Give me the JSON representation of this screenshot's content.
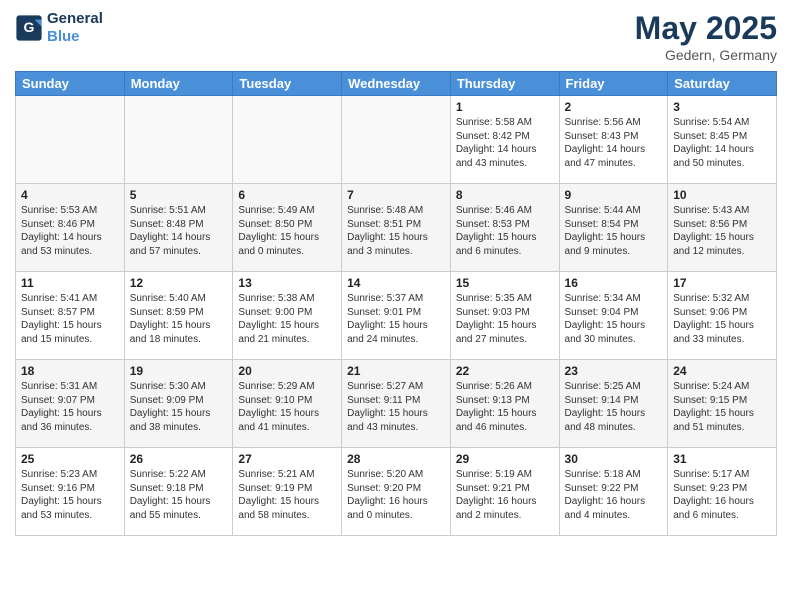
{
  "logo": {
    "line1": "General",
    "line2": "Blue"
  },
  "title": "May 2025",
  "subtitle": "Gedern, Germany",
  "days_header": [
    "Sunday",
    "Monday",
    "Tuesday",
    "Wednesday",
    "Thursday",
    "Friday",
    "Saturday"
  ],
  "weeks": [
    [
      {
        "day": "",
        "content": ""
      },
      {
        "day": "",
        "content": ""
      },
      {
        "day": "",
        "content": ""
      },
      {
        "day": "",
        "content": ""
      },
      {
        "day": "1",
        "content": "Sunrise: 5:58 AM\nSunset: 8:42 PM\nDaylight: 14 hours\nand 43 minutes."
      },
      {
        "day": "2",
        "content": "Sunrise: 5:56 AM\nSunset: 8:43 PM\nDaylight: 14 hours\nand 47 minutes."
      },
      {
        "day": "3",
        "content": "Sunrise: 5:54 AM\nSunset: 8:45 PM\nDaylight: 14 hours\nand 50 minutes."
      }
    ],
    [
      {
        "day": "4",
        "content": "Sunrise: 5:53 AM\nSunset: 8:46 PM\nDaylight: 14 hours\nand 53 minutes."
      },
      {
        "day": "5",
        "content": "Sunrise: 5:51 AM\nSunset: 8:48 PM\nDaylight: 14 hours\nand 57 minutes."
      },
      {
        "day": "6",
        "content": "Sunrise: 5:49 AM\nSunset: 8:50 PM\nDaylight: 15 hours\nand 0 minutes."
      },
      {
        "day": "7",
        "content": "Sunrise: 5:48 AM\nSunset: 8:51 PM\nDaylight: 15 hours\nand 3 minutes."
      },
      {
        "day": "8",
        "content": "Sunrise: 5:46 AM\nSunset: 8:53 PM\nDaylight: 15 hours\nand 6 minutes."
      },
      {
        "day": "9",
        "content": "Sunrise: 5:44 AM\nSunset: 8:54 PM\nDaylight: 15 hours\nand 9 minutes."
      },
      {
        "day": "10",
        "content": "Sunrise: 5:43 AM\nSunset: 8:56 PM\nDaylight: 15 hours\nand 12 minutes."
      }
    ],
    [
      {
        "day": "11",
        "content": "Sunrise: 5:41 AM\nSunset: 8:57 PM\nDaylight: 15 hours\nand 15 minutes."
      },
      {
        "day": "12",
        "content": "Sunrise: 5:40 AM\nSunset: 8:59 PM\nDaylight: 15 hours\nand 18 minutes."
      },
      {
        "day": "13",
        "content": "Sunrise: 5:38 AM\nSunset: 9:00 PM\nDaylight: 15 hours\nand 21 minutes."
      },
      {
        "day": "14",
        "content": "Sunrise: 5:37 AM\nSunset: 9:01 PM\nDaylight: 15 hours\nand 24 minutes."
      },
      {
        "day": "15",
        "content": "Sunrise: 5:35 AM\nSunset: 9:03 PM\nDaylight: 15 hours\nand 27 minutes."
      },
      {
        "day": "16",
        "content": "Sunrise: 5:34 AM\nSunset: 9:04 PM\nDaylight: 15 hours\nand 30 minutes."
      },
      {
        "day": "17",
        "content": "Sunrise: 5:32 AM\nSunset: 9:06 PM\nDaylight: 15 hours\nand 33 minutes."
      }
    ],
    [
      {
        "day": "18",
        "content": "Sunrise: 5:31 AM\nSunset: 9:07 PM\nDaylight: 15 hours\nand 36 minutes."
      },
      {
        "day": "19",
        "content": "Sunrise: 5:30 AM\nSunset: 9:09 PM\nDaylight: 15 hours\nand 38 minutes."
      },
      {
        "day": "20",
        "content": "Sunrise: 5:29 AM\nSunset: 9:10 PM\nDaylight: 15 hours\nand 41 minutes."
      },
      {
        "day": "21",
        "content": "Sunrise: 5:27 AM\nSunset: 9:11 PM\nDaylight: 15 hours\nand 43 minutes."
      },
      {
        "day": "22",
        "content": "Sunrise: 5:26 AM\nSunset: 9:13 PM\nDaylight: 15 hours\nand 46 minutes."
      },
      {
        "day": "23",
        "content": "Sunrise: 5:25 AM\nSunset: 9:14 PM\nDaylight: 15 hours\nand 48 minutes."
      },
      {
        "day": "24",
        "content": "Sunrise: 5:24 AM\nSunset: 9:15 PM\nDaylight: 15 hours\nand 51 minutes."
      }
    ],
    [
      {
        "day": "25",
        "content": "Sunrise: 5:23 AM\nSunset: 9:16 PM\nDaylight: 15 hours\nand 53 minutes."
      },
      {
        "day": "26",
        "content": "Sunrise: 5:22 AM\nSunset: 9:18 PM\nDaylight: 15 hours\nand 55 minutes."
      },
      {
        "day": "27",
        "content": "Sunrise: 5:21 AM\nSunset: 9:19 PM\nDaylight: 15 hours\nand 58 minutes."
      },
      {
        "day": "28",
        "content": "Sunrise: 5:20 AM\nSunset: 9:20 PM\nDaylight: 16 hours\nand 0 minutes."
      },
      {
        "day": "29",
        "content": "Sunrise: 5:19 AM\nSunset: 9:21 PM\nDaylight: 16 hours\nand 2 minutes."
      },
      {
        "day": "30",
        "content": "Sunrise: 5:18 AM\nSunset: 9:22 PM\nDaylight: 16 hours\nand 4 minutes."
      },
      {
        "day": "31",
        "content": "Sunrise: 5:17 AM\nSunset: 9:23 PM\nDaylight: 16 hours\nand 6 minutes."
      }
    ]
  ]
}
